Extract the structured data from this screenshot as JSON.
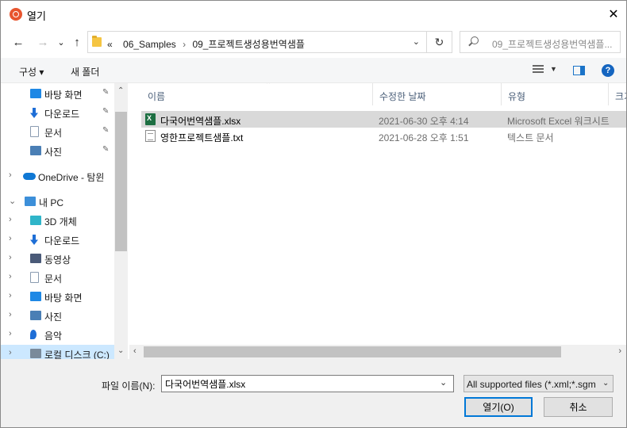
{
  "window": {
    "title": "열기"
  },
  "nav": {
    "back": "←",
    "forward": "→",
    "history": "⌄",
    "up": "↑",
    "address": {
      "overflow": "«",
      "crumbs": [
        "06_Samples",
        "09_프로젝트생성용번역샘플"
      ]
    },
    "refresh": "↻",
    "search_placeholder": "09_프로젝트생성용번역샘플..."
  },
  "commands": {
    "organize": "구성 ▾",
    "new_folder": "새 폴더",
    "help": "?"
  },
  "sidebar": {
    "items": [
      {
        "label": "바탕 화면",
        "icon": "desktop-icon",
        "pinned": true,
        "color": "#1e88e5"
      },
      {
        "label": "다운로드",
        "icon": "download-icon",
        "pinned": true,
        "color": "#1e6ed6"
      },
      {
        "label": "문서",
        "icon": "documents-icon",
        "pinned": true,
        "color": "#8a9bb0"
      },
      {
        "label": "사진",
        "icon": "pictures-icon",
        "pinned": true,
        "color": "#4a7fb5"
      },
      {
        "label": "OneDrive - 탐윈",
        "icon": "onedrive-icon",
        "color": "#0f78d4"
      },
      {
        "label": "내 PC",
        "icon": "pc-icon",
        "color": "#3c8fd9"
      },
      {
        "label": "3D 개체",
        "icon": "3d-objects-icon",
        "color": "#2fb5c9"
      },
      {
        "label": "다운로드",
        "icon": "download-icon",
        "color": "#1e6ed6"
      },
      {
        "label": "동영상",
        "icon": "videos-icon",
        "color": "#4a5a78"
      },
      {
        "label": "문서",
        "icon": "documents-icon",
        "color": "#8a9bb0"
      },
      {
        "label": "바탕 화면",
        "icon": "desktop-icon",
        "color": "#1e88e5"
      },
      {
        "label": "사진",
        "icon": "pictures-icon",
        "color": "#4a7fb5"
      },
      {
        "label": "음악",
        "icon": "music-icon",
        "color": "#1e6ed6"
      },
      {
        "label": "로컬 디스크 (C:)",
        "icon": "drive-icon",
        "color": "#7a8a9a",
        "selected": true
      }
    ]
  },
  "columns": {
    "name": "이름",
    "date": "수정한 날짜",
    "type": "유형",
    "size": "크기"
  },
  "files": [
    {
      "name": "다국어번역샘플.xlsx",
      "date": "2021-06-30 오후 4:14",
      "type": "Microsoft Excel 워크시트",
      "icon": "excel-file-icon",
      "selected": true
    },
    {
      "name": "영한프로젝트샘플.txt",
      "date": "2021-06-28 오후 1:51",
      "type": "텍스트 문서",
      "icon": "text-file-icon",
      "selected": false
    }
  ],
  "footer": {
    "filename_label": "파일 이름(N):",
    "filename_value": "다국어번역샘플.xlsx",
    "filter": "All supported files (*.xml;*.sgm",
    "open": "열기(O)",
    "cancel": "취소"
  },
  "colors": {
    "accent": "#0078d7",
    "selection": "#cce8ff",
    "app_icon": "#e8552e"
  }
}
